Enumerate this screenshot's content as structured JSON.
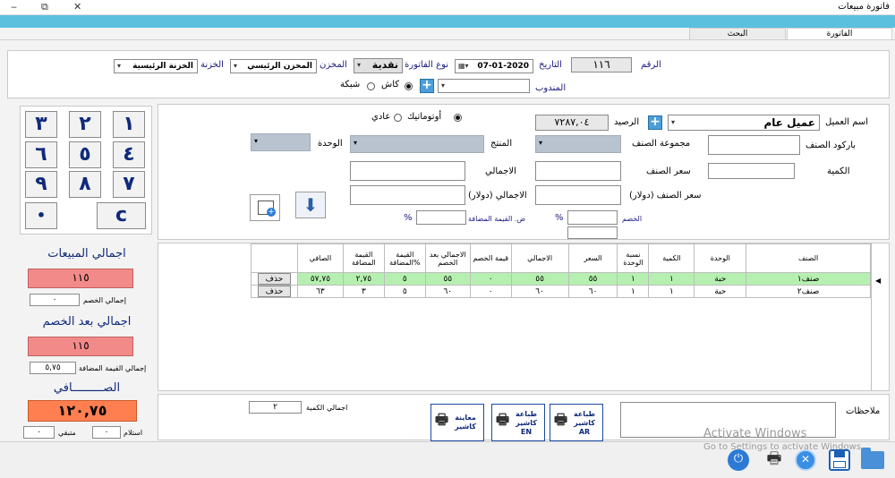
{
  "window": {
    "title": "فاتورة مبيعات",
    "min": "‒",
    "max": "⧉",
    "close": "✕"
  },
  "tabs": [
    {
      "label": "الفاتورة"
    },
    {
      "label": "البحث"
    }
  ],
  "header": {
    "number_label": "الرقم",
    "number_value": "١١٦",
    "date_label": "التاريخ",
    "date_value": "07-01-2020",
    "invoice_type_label": "نوع الفاتورة",
    "invoice_type_value": "نقدية",
    "store_label": "المخزن",
    "store_value": "المخزن الرئيسي",
    "cashbox_label": "الخزنة",
    "cashbox_value": "الخزنة الرئيسية",
    "rep_label": "المندوب",
    "rep_value": "",
    "cash_label": "كاش",
    "network_label": "شبكة"
  },
  "entry": {
    "customer_label": "اسم العميل",
    "customer_value": "عميل عام",
    "balance_label": "الرصيد",
    "balance_value": "٧٢٨٧,٠٤",
    "auto_label": "أوتوماتيك",
    "normal_label": "عادي",
    "barcode_label": "باركود الصنف",
    "group_label": "مجموعة الصنف",
    "product_label": "المنتج",
    "unit_label": "الوحدة",
    "qty_label": "الكمية",
    "price_label": "سعر الصنف",
    "total_label": "الاجمالي",
    "price_usd_label": "سعر الصنف (دولار)",
    "total_usd_label": "الاجمالي (دولار)",
    "discount_label": "الخصم",
    "discount_pct": "%",
    "vat_label": "ض. القيمة المضافة",
    "vat_pct": "%"
  },
  "keypad": {
    "keys": [
      "١",
      "٢",
      "٣",
      "٤",
      "٥",
      "٦",
      "٧",
      "٨",
      "٩",
      "•",
      "c"
    ]
  },
  "totals": {
    "sales_title": "اجمالي المبيعات",
    "sales_value": "١١٥",
    "discount_label": "إجمالي الخصم",
    "discount_value": "٠",
    "after_discount_title": "اجمالي بعد الخصم",
    "after_discount_value": "١١٥",
    "vat_label": "إجمالي القيمة المضافة",
    "vat_value": "٥,٧٥",
    "net_title": "الصـــــــــافي",
    "net_value": "١٢٠,٧٥",
    "received_label": "استلام",
    "received_value": "٠",
    "remaining_label": "متبقي",
    "remaining_value": "٠"
  },
  "grid": {
    "columns": [
      "الصنف",
      "الوحدة",
      "الكمية",
      "نسبة الوحدة",
      "السعر",
      "الاجمالي",
      "قيمة الخصم",
      "الاجمالي بعد الخصم",
      "القيمة المضافة%",
      "القيمة المضافة",
      "الصافي"
    ],
    "rows": [
      {
        "item": "صنف١",
        "unit": "حبة",
        "qty": "١",
        "ratio": "١",
        "price": "٥٥",
        "total": "٥٥",
        "disc": "٠",
        "after": "٥٥",
        "vat_pct": "٥",
        "vat": "٢,٧٥",
        "net": "٥٧,٧٥",
        "delete": "حذف"
      },
      {
        "item": "صنف٢",
        "unit": "حبة",
        "qty": "١",
        "ratio": "١",
        "price": "٦٠",
        "total": "٦٠",
        "disc": "٠",
        "after": "٦٠",
        "vat_pct": "٥",
        "vat": "٣",
        "net": "٦٣",
        "delete": "حذف"
      }
    ]
  },
  "footer": {
    "notes_label": "ملاحظات",
    "qty_total_label": "اجمالي الكمية",
    "qty_total_value": "٢",
    "print_ar": "طباعة كاشير AR",
    "print_en": "طباعة كاشير EN",
    "preview": "معاينة كاشير"
  },
  "watermark": {
    "line1": "Activate Windows",
    "line2": "Go to Settings to activate Windows."
  },
  "colors": {
    "accent": "#5bc0de",
    "selected_row": "#b6f0b0",
    "totals_red": "#f28a8a",
    "net_orange": "#ff7f50",
    "keypad_text": "#102a7a"
  }
}
